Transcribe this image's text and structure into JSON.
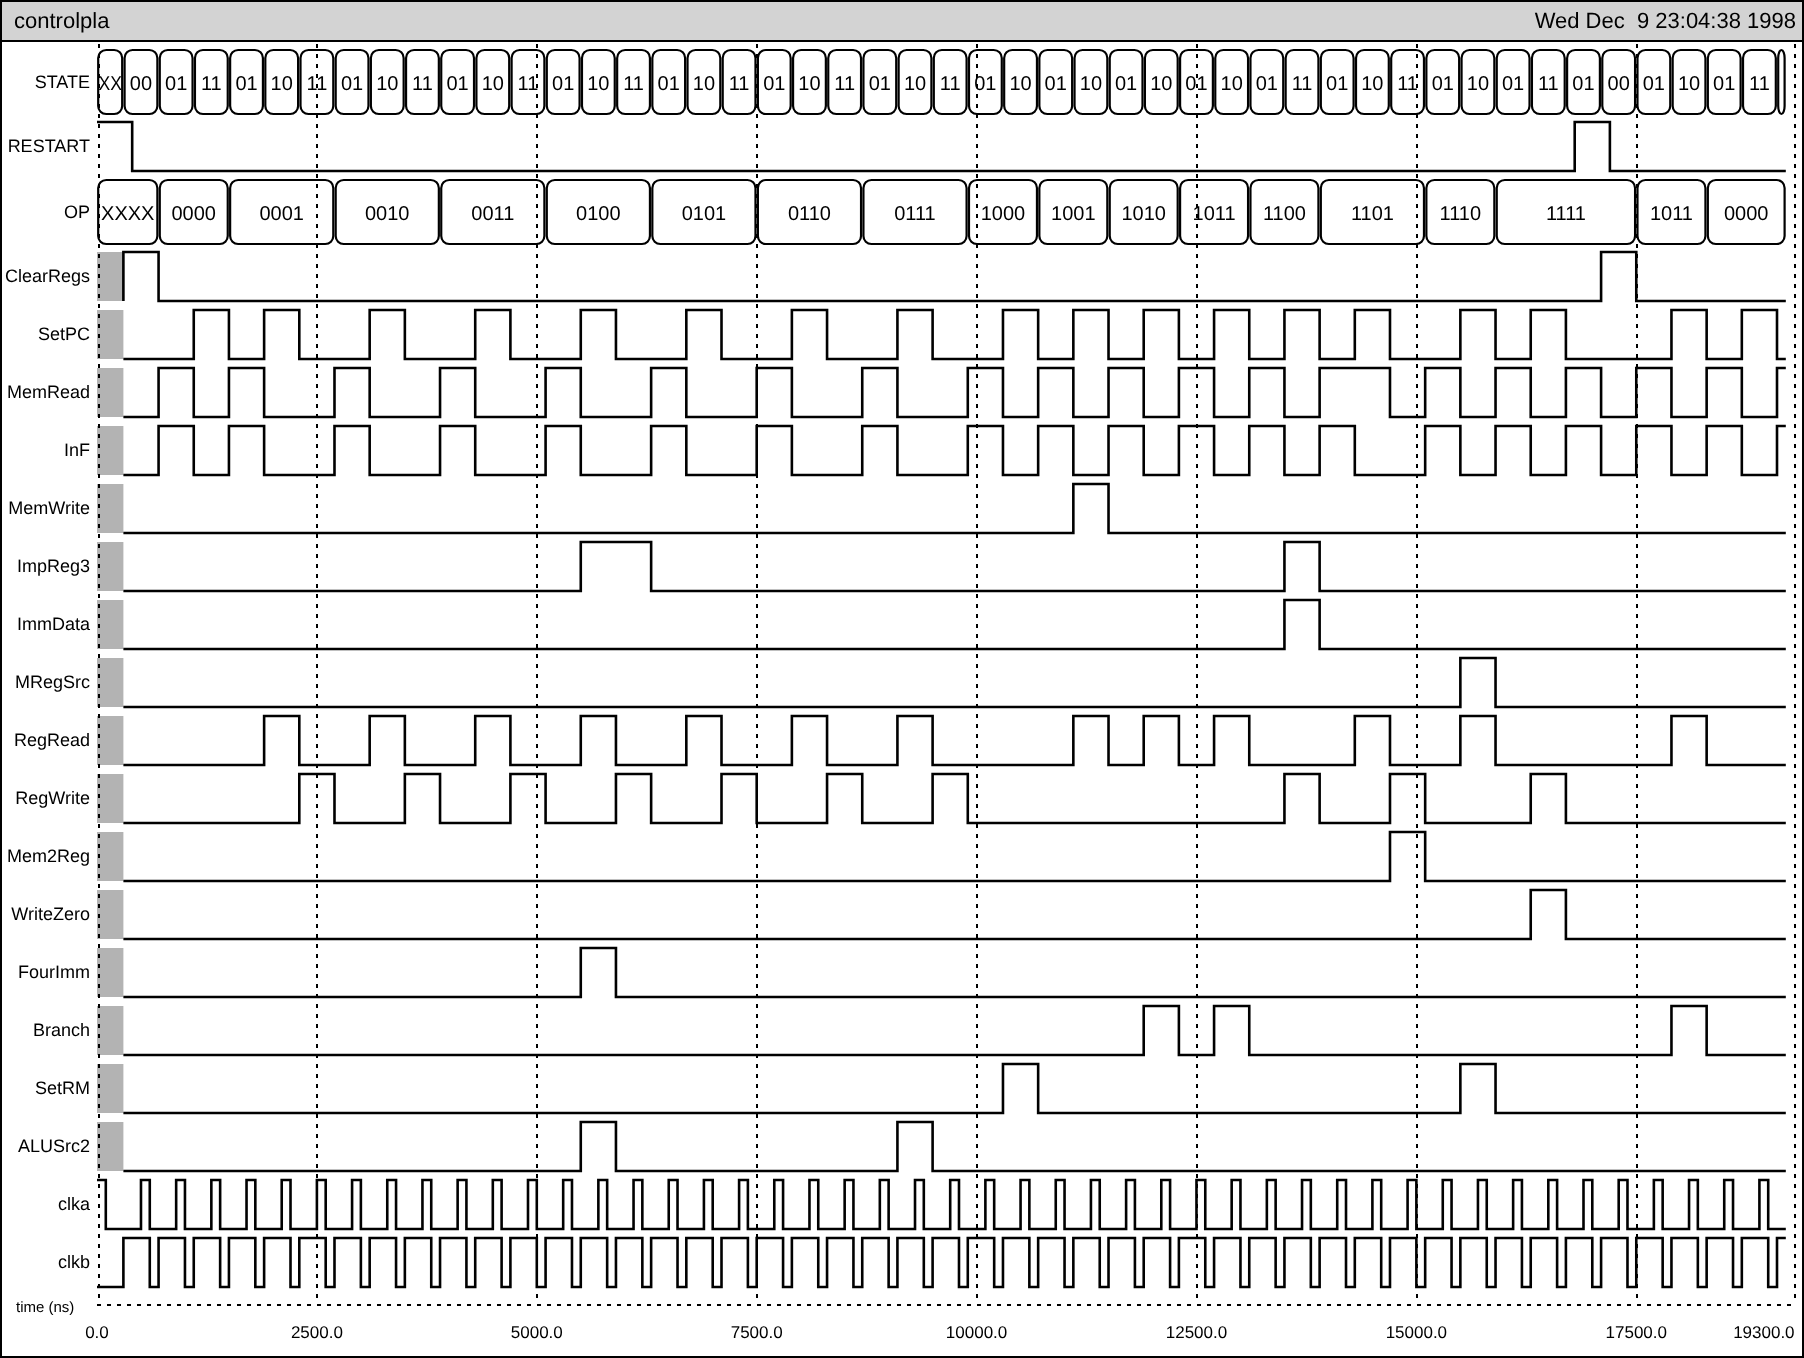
{
  "window": {
    "title": "controlpla",
    "timestamp": "Wed Dec  9 23:04:38 1998"
  },
  "signals": [
    {
      "name": "STATE",
      "kind": "bus",
      "values": [
        "XX",
        "00",
        "01",
        "11",
        "01",
        "10",
        "11",
        "01",
        "10",
        "11",
        "01",
        "10",
        "11",
        "01",
        "10",
        "11",
        "01",
        "10",
        "11",
        "01",
        "10",
        "11",
        "01",
        "10",
        "11",
        "01",
        "10",
        "01",
        "10",
        "01",
        "10",
        "01",
        "10",
        "01",
        "11",
        "01",
        "10",
        "11",
        "01",
        "10",
        "01",
        "11",
        "01",
        "00",
        "01",
        "10",
        "01",
        "11"
      ]
    },
    {
      "name": "RESTART",
      "kind": "bit"
    },
    {
      "name": "OP",
      "kind": "bus",
      "values": [
        "XXXX",
        "0000",
        "0001",
        "0010",
        "0011",
        "0100",
        "0101",
        "0110",
        "0111",
        "1000",
        "1001",
        "1010",
        "1011",
        "1100",
        "1101",
        "1110",
        "1111",
        "1011",
        "0000"
      ]
    },
    {
      "name": "ClearRegs",
      "kind": "bit"
    },
    {
      "name": "SetPC",
      "kind": "bit"
    },
    {
      "name": "MemRead",
      "kind": "bit"
    },
    {
      "name": "InF",
      "kind": "bit"
    },
    {
      "name": "MemWrite",
      "kind": "bit"
    },
    {
      "name": "ImpReg3",
      "kind": "bit"
    },
    {
      "name": "ImmData",
      "kind": "bit"
    },
    {
      "name": "MRegSrc",
      "kind": "bit"
    },
    {
      "name": "RegRead",
      "kind": "bit"
    },
    {
      "name": "RegWrite",
      "kind": "bit"
    },
    {
      "name": "Mem2Reg",
      "kind": "bit"
    },
    {
      "name": "WriteZero",
      "kind": "bit"
    },
    {
      "name": "FourImm",
      "kind": "bit"
    },
    {
      "name": "Branch",
      "kind": "bit"
    },
    {
      "name": "SetRM",
      "kind": "bit"
    },
    {
      "name": "ALUSrc2",
      "kind": "bit"
    },
    {
      "name": "clka",
      "kind": "bit"
    },
    {
      "name": "clkb",
      "kind": "bit"
    }
  ],
  "time_axis": {
    "title": "time (ns)",
    "ticks": [
      "0.0",
      "2500.0",
      "5000.0",
      "7500.0",
      "10000.0",
      "12500.0",
      "15000.0",
      "17500.0",
      "19300.0"
    ]
  }
}
